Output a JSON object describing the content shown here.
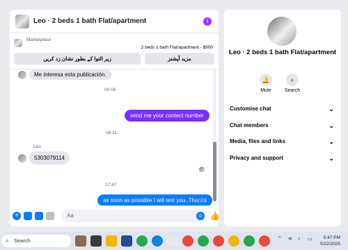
{
  "header": {
    "title": "Leo · 2 beds 1 bath Flat/apartment",
    "info_icon": "info-icon"
  },
  "marketplace": {
    "label": "Marketplace",
    "listing": "2 beds 1 bath Flat/apartment - $900",
    "buttons": [
      "زیر التوا کے بطور نشان زد کریں",
      "مزید آپشنز"
    ]
  },
  "messages": {
    "m1": "Me interesa esta publicación.",
    "t1": "00:06",
    "m2": "send me your contect number",
    "t2": "06:11",
    "sender": "Leo",
    "m3": "5303079114",
    "t3": "17:47",
    "m4": "as soon as possible I will text you..Thanks",
    "status": "Sent"
  },
  "composer": {
    "placeholder": "Aa"
  },
  "sidebar": {
    "name": "Leo · 2 beds 1 bath Flat/apartment",
    "actions": [
      {
        "label": "Mute",
        "icon": "bell-icon"
      },
      {
        "label": "Search",
        "icon": "search-icon"
      }
    ],
    "sections": [
      "Customise chat",
      "Chat members",
      "Media, files and links",
      "Privacy and support"
    ]
  },
  "taskbar": {
    "search": "Search",
    "time": "5:47 PM",
    "date": "5/22/2025"
  },
  "colors": {
    "accent": "#7a30ff",
    "blue": "#0a7cff",
    "bubble_gray": "#e4e6eb"
  }
}
